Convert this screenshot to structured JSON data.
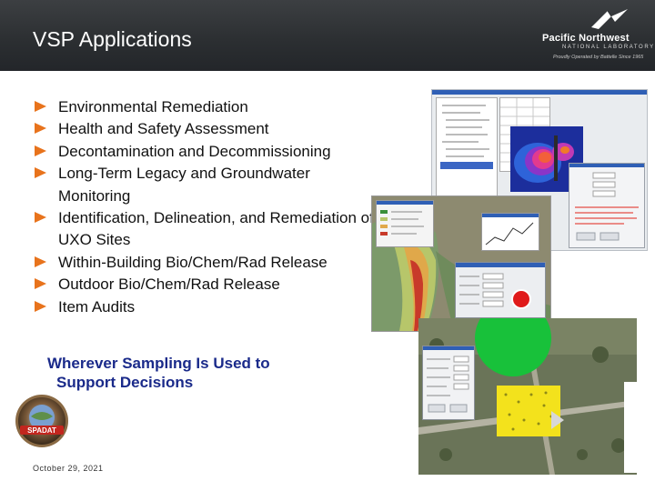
{
  "slide": {
    "title": "VSP Applications",
    "date": "October 29, 2021"
  },
  "logo": {
    "line1": "Pacific Northwest",
    "line2": "NATIONAL LABORATORY",
    "line3": "Proudly Operated by Battelle Since 1965"
  },
  "bullets": [
    "Environmental Remediation",
    "Health and Safety Assessment",
    "Decontamination and Decommissioning",
    "Long-Term Legacy and Groundwater Monitoring",
    "Identification, Delineation, and Remediation of UXO Sites",
    "Within-Building Bio/Chem/Rad Release",
    "Outdoor Bio/Chem/Rad Release",
    "Item Audits"
  ],
  "tagline": {
    "line1": "Wherever Sampling Is Used to",
    "line2": "Support Decisions"
  },
  "seal": {
    "text": "SPADAT"
  },
  "colors": {
    "header_bg": "#2b2e31",
    "bullet_arrow": "#e8731c",
    "tagline": "#1a2a8a"
  },
  "images": [
    {
      "name": "vsp-hotspot-map-screenshot",
      "icon": "software-window"
    },
    {
      "name": "vsp-geostat-contour-screenshot",
      "icon": "software-window"
    },
    {
      "name": "vsp-aerial-sampling-screenshot",
      "icon": "aerial-photo"
    }
  ]
}
